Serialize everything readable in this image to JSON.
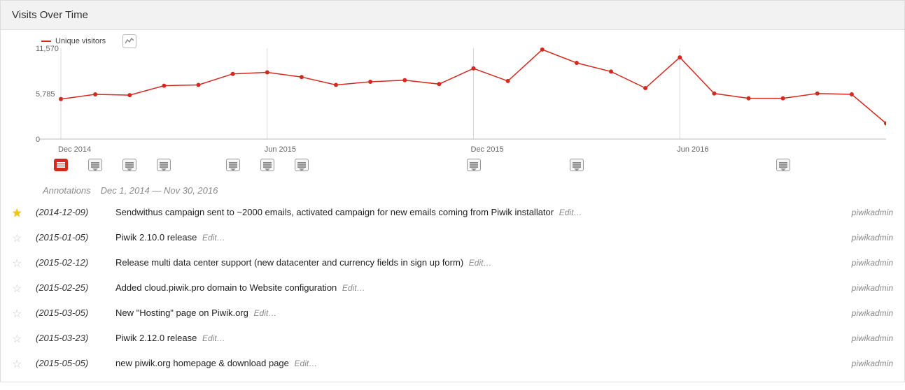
{
  "widget": {
    "title": "Visits Over Time"
  },
  "legend": {
    "series_name": "Unique visitors"
  },
  "annotations_header": {
    "label": "Annotations",
    "range": "Dec 1, 2014 — Nov 30, 2016"
  },
  "edit_label": "Edit…",
  "annotations": [
    {
      "starred": true,
      "date": "(2014-12-09)",
      "text": "Sendwithus campaign sent to ~2000 emails, activated campaign for new emails coming from Piwik installator",
      "user": "piwikadmin"
    },
    {
      "starred": false,
      "date": "(2015-01-05)",
      "text": "Piwik 2.10.0 release",
      "user": "piwikadmin"
    },
    {
      "starred": false,
      "date": "(2015-02-12)",
      "text": "Release multi data center support (new datacenter and currency fields in sign up form)",
      "user": "piwikadmin"
    },
    {
      "starred": false,
      "date": "(2015-02-25)",
      "text": "Added cloud.piwik.pro domain to Website configuration",
      "user": "piwikadmin"
    },
    {
      "starred": false,
      "date": "(2015-03-05)",
      "text": "New \"Hosting\" page on Piwik.org",
      "user": "piwikadmin"
    },
    {
      "starred": false,
      "date": "(2015-03-23)",
      "text": "Piwik 2.12.0 release",
      "user": "piwikadmin"
    },
    {
      "starred": false,
      "date": "(2015-05-05)",
      "text": "new piwik.org homepage & download page",
      "user": "piwikadmin"
    }
  ],
  "annotation_markers": [
    {
      "month_index": 0,
      "active": true
    },
    {
      "month_index": 1,
      "active": false
    },
    {
      "month_index": 2,
      "active": false
    },
    {
      "month_index": 3,
      "active": false
    },
    {
      "month_index": 5,
      "active": false
    },
    {
      "month_index": 6,
      "active": false
    },
    {
      "month_index": 7,
      "active": false
    },
    {
      "month_index": 12,
      "active": false
    },
    {
      "month_index": 15,
      "active": false
    },
    {
      "month_index": 21,
      "active": false
    }
  ],
  "chart_data": {
    "type": "line",
    "title": "Visits Over Time",
    "xlabel": "",
    "ylabel": "",
    "ylim": [
      0,
      11570
    ],
    "y_ticks": [
      0,
      5785,
      11570
    ],
    "x_ticks": [
      {
        "index": 0,
        "label": "Dec 2014"
      },
      {
        "index": 6,
        "label": "Jun 2015"
      },
      {
        "index": 12,
        "label": "Dec 2015"
      },
      {
        "index": 18,
        "label": "Jun 2016"
      }
    ],
    "categories": [
      "Dec 2014",
      "Jan 2015",
      "Feb 2015",
      "Mar 2015",
      "Apr 2015",
      "May 2015",
      "Jun 2015",
      "Jul 2015",
      "Aug 2015",
      "Sep 2015",
      "Oct 2015",
      "Nov 2015",
      "Dec 2015",
      "Jan 2016",
      "Feb 2016",
      "Mar 2016",
      "Apr 2016",
      "May 2016",
      "Jun 2016",
      "Jul 2016",
      "Aug 2016",
      "Sep 2016",
      "Oct 2016",
      "Nov 2016"
    ],
    "series": [
      {
        "name": "Unique visitors",
        "color": "#d4291f",
        "values": [
          5100,
          5700,
          5600,
          6800,
          6900,
          8300,
          8500,
          7900,
          6900,
          7300,
          7500,
          7000,
          9000,
          7400,
          11400,
          9700,
          8600,
          6500,
          10400,
          5800,
          5200,
          5200,
          5800,
          5700
        ]
      }
    ],
    "extra_tail": {
      "label": "Dec 2016",
      "value": 2000
    }
  }
}
